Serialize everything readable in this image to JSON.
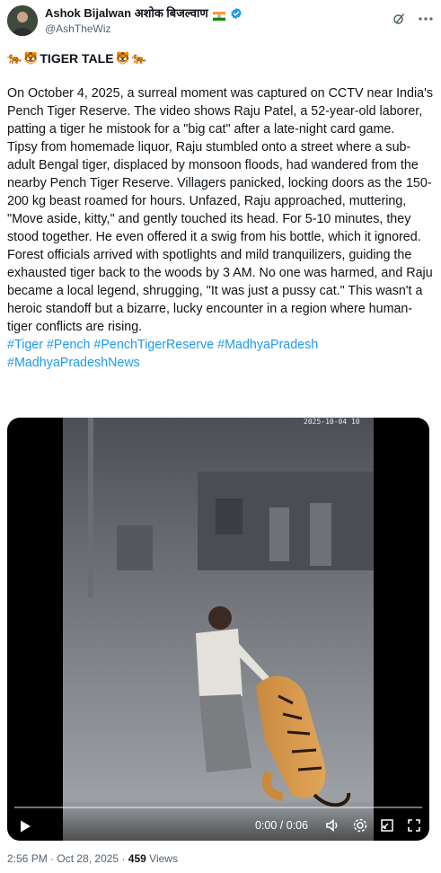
{
  "user": {
    "display_name": "Ashok Bijalwan अशोक बिजल्वाण",
    "handle": "@AshTheWiz",
    "avatar_icon": "avatar-photo",
    "verified_icon": "verified-badge-icon",
    "flag_icon": "india-flag-icon"
  },
  "top_actions": [
    "grok-icon",
    "more-icon"
  ],
  "post": {
    "title": "TIGER TALE",
    "title_emojis": [
      "tiger-icon",
      "tiger-face-icon"
    ],
    "paragraphs": [
      "On October 4, 2025, a surreal moment was captured on CCTV near India's Pench Tiger Reserve. The video shows Raju Patel, a 52-year-old laborer, patting a tiger he mistook for a \"big cat\" after a late-night card game.",
      "Tipsy from homemade liquor, Raju stumbled onto a street where a sub-adult Bengal tiger, displaced by monsoon floods, had wandered from the nearby Pench Tiger Reserve.  Villagers panicked, locking doors as the 150-200 kg beast roamed for hours. Unfazed, Raju approached, muttering, \"Move aside, kitty,\" and gently touched its head. For 5-10 minutes, they stood together. He even offered it a swig from his bottle, which it ignored.",
      "Forest officials arrived with spotlights and mild tranquilizers, guiding the exhausted tiger back to the woods by 3 AM. No one was harmed, and Raju became a local legend, shrugging, \"It was just a pussy cat.\"  This wasn't a heroic standoff but a bizarre, lucky encounter in a region where human-tiger conflicts are rising."
    ],
    "hashtags": "#Tiger #Pench #PenchTigerReserve #MadhyaPradesh #MadhyaPradeshNews"
  },
  "video": {
    "cctv_timestamp": "2025-10-04  10",
    "time": "0:00 / 0:06",
    "progress": 0,
    "control_icons": [
      "play-icon",
      "volume-icon",
      "settings-icon",
      "picture-in-picture-icon",
      "fullscreen-icon"
    ]
  },
  "meta": {
    "time": "2:56 PM",
    "date": "Oct 28, 2025",
    "views_count": "459",
    "views_label": "Views"
  }
}
